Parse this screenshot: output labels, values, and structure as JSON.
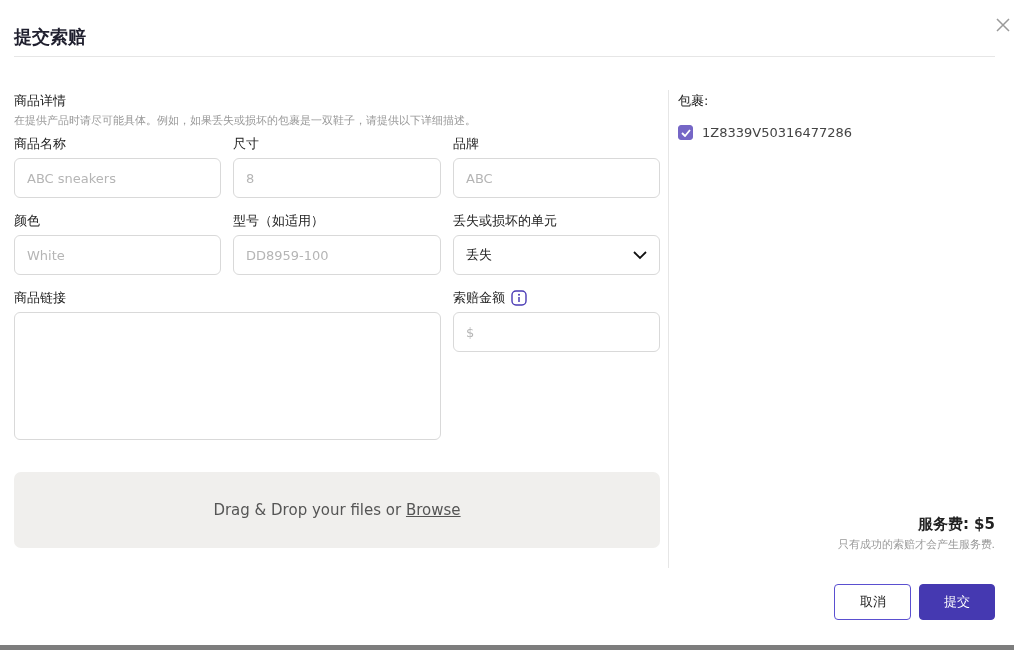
{
  "dialog": {
    "title": "提交索赔"
  },
  "product_details": {
    "heading": "商品详情",
    "hint": "在提供产品时请尽可能具体。例如，如果丢失或损坏的包裹是一双鞋子，请提供以下详细描述。"
  },
  "fields": [
    {
      "kind": "input",
      "label": "商品名称",
      "placeholder": "ABC sneakers"
    },
    {
      "kind": "input",
      "label": "尺寸",
      "placeholder": "8"
    },
    {
      "kind": "input",
      "label": "品牌",
      "placeholder": "ABC"
    },
    {
      "kind": "input",
      "label": "颜色",
      "placeholder": "White"
    },
    {
      "kind": "input",
      "label": "型号（如适用）",
      "placeholder": "DD8959-100"
    },
    {
      "kind": "select",
      "label": "丢失或损坏的单元",
      "value": "丢失"
    },
    {
      "kind": "textarea",
      "label": "商品链接"
    },
    {
      "kind": "amount",
      "label": "索赔金额",
      "placeholder": "$",
      "info": true
    }
  ],
  "upload": {
    "text": "Drag & Drop your files or ",
    "link": "Browse"
  },
  "packages": {
    "label": "包裹:",
    "items": [
      {
        "tracking": "1Z8339V50316477286",
        "checked": true
      }
    ]
  },
  "fee": {
    "title": "服务费: $5",
    "note": "只有成功的索赔才会产生服务费."
  },
  "buttons": [
    {
      "kind": "secondary",
      "label": "取消"
    },
    {
      "kind": "primary",
      "label": "提交"
    }
  ]
}
